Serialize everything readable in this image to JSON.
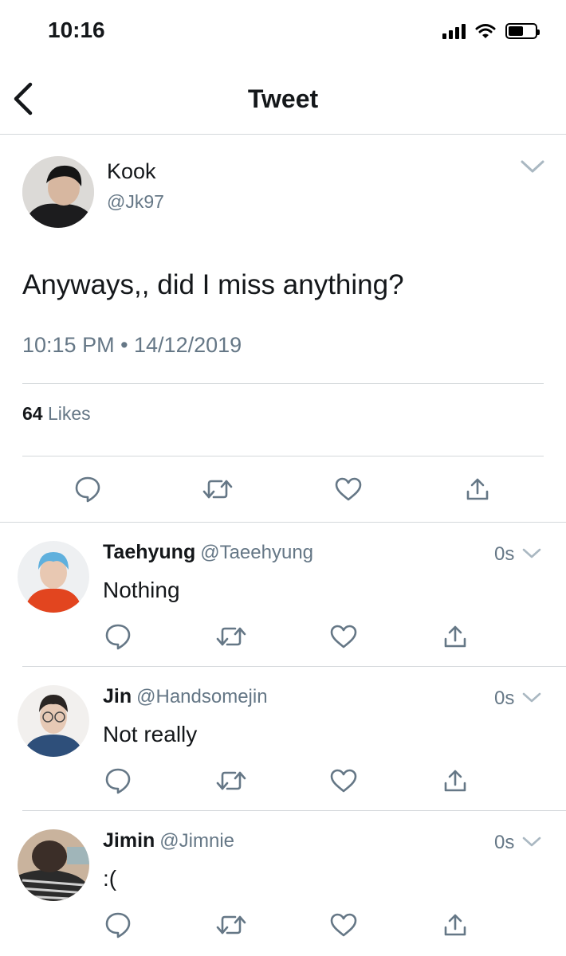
{
  "status_bar": {
    "time": "10:16"
  },
  "nav": {
    "title": "Tweet"
  },
  "tweet": {
    "name": "Kook",
    "handle": "@Jk97",
    "text": "Anyways,, did I miss anything?",
    "timestamp": "10:15 PM • 14/12/2019",
    "likes_count": "64",
    "likes_label": "Likes"
  },
  "replies": [
    {
      "name": "Taehyung",
      "handle": "@Taeehyung",
      "text": "Nothing",
      "time": "0s"
    },
    {
      "name": "Jin",
      "handle": "@Handsomejin",
      "text": "Not really",
      "time": "0s"
    },
    {
      "name": "Jimin",
      "handle": "@Jimnie",
      "text": ":(",
      "time": "0s"
    }
  ],
  "colors": {
    "text": "#14171a",
    "secondary": "#657786",
    "icon": "#657786",
    "divider": "#d4d8db"
  },
  "icons": [
    "chevron-left-icon",
    "chevron-down-icon",
    "reply-icon",
    "retweet-icon",
    "like-icon",
    "share-icon"
  ]
}
